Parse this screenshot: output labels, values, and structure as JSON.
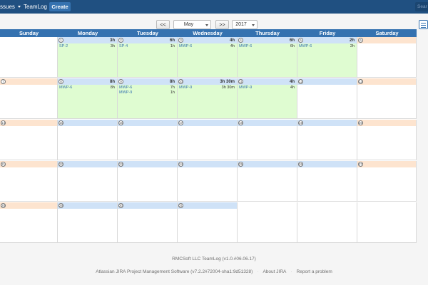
{
  "nav": {
    "issues_label": "ssues",
    "teamlog_label": "TeamLog",
    "create_label": "Create",
    "search_placeholder": "Sear"
  },
  "controls": {
    "prev_label": "<<",
    "next_label": ">>",
    "month": "May",
    "year": "2017"
  },
  "calendar": {
    "day_names": [
      "Sunday",
      "Monday",
      "Tuesday",
      "Wednesday",
      "Thursday",
      "Friday",
      "Saturday"
    ],
    "weeks": [
      {
        "days": [
          {
            "day": "",
            "total": "",
            "worked": false,
            "entries": []
          },
          {
            "day": "1",
            "total": "3h",
            "worked": true,
            "entries": [
              {
                "key": "SP-2",
                "hours": "3h"
              }
            ]
          },
          {
            "day": "2",
            "total": "6h",
            "worked": true,
            "entries": [
              {
                "key": "SP-4",
                "hours": "1h"
              }
            ]
          },
          {
            "day": "3",
            "total": "4h",
            "worked": true,
            "entries": [
              {
                "key": "MWP-6",
                "hours": "4h"
              }
            ]
          },
          {
            "day": "4",
            "total": "6h",
            "worked": true,
            "entries": [
              {
                "key": "MWP-6",
                "hours": "6h"
              }
            ]
          },
          {
            "day": "5",
            "total": "2h",
            "worked": true,
            "entries": [
              {
                "key": "MWP-6",
                "hours": "2h"
              }
            ]
          },
          {
            "day": "6",
            "total": "",
            "worked": false,
            "entries": []
          }
        ]
      },
      {
        "days": [
          {
            "day": "7",
            "total": "",
            "worked": false,
            "entries": []
          },
          {
            "day": "8",
            "total": "8h",
            "worked": true,
            "entries": [
              {
                "key": "MWP-6",
                "hours": "8h"
              }
            ]
          },
          {
            "day": "9",
            "total": "8h",
            "worked": true,
            "entries": [
              {
                "key": "MWP-6",
                "hours": "7h"
              },
              {
                "key": "MWP-9",
                "hours": "1h"
              }
            ]
          },
          {
            "day": "10",
            "total": "3h 30m",
            "worked": true,
            "entries": [
              {
                "key": "MWP-9",
                "hours": "3h 30m"
              }
            ]
          },
          {
            "day": "11",
            "total": "4h",
            "worked": true,
            "entries": [
              {
                "key": "MWP-9",
                "hours": "4h"
              }
            ]
          },
          {
            "day": "12",
            "total": "",
            "worked": false,
            "entries": []
          },
          {
            "day": "13",
            "total": "",
            "worked": false,
            "entries": []
          }
        ]
      },
      {
        "days": [
          {
            "day": "14",
            "total": "",
            "worked": false,
            "entries": []
          },
          {
            "day": "15",
            "total": "",
            "worked": false,
            "entries": []
          },
          {
            "day": "16",
            "total": "",
            "worked": false,
            "entries": []
          },
          {
            "day": "17",
            "total": "",
            "worked": false,
            "entries": []
          },
          {
            "day": "18",
            "total": "",
            "worked": false,
            "entries": []
          },
          {
            "day": "19",
            "total": "",
            "worked": false,
            "entries": []
          },
          {
            "day": "20",
            "total": "",
            "worked": false,
            "entries": []
          }
        ]
      },
      {
        "days": [
          {
            "day": "21",
            "total": "",
            "worked": false,
            "entries": []
          },
          {
            "day": "22",
            "total": "",
            "worked": false,
            "entries": []
          },
          {
            "day": "23",
            "total": "",
            "worked": false,
            "entries": []
          },
          {
            "day": "24",
            "total": "",
            "worked": false,
            "entries": []
          },
          {
            "day": "25",
            "total": "",
            "worked": false,
            "entries": []
          },
          {
            "day": "26",
            "total": "",
            "worked": false,
            "entries": []
          },
          {
            "day": "27",
            "total": "",
            "worked": false,
            "entries": []
          }
        ]
      },
      {
        "days": [
          {
            "day": "28",
            "total": "",
            "worked": false,
            "entries": []
          },
          {
            "day": "29",
            "total": "",
            "worked": false,
            "entries": []
          },
          {
            "day": "30",
            "total": "",
            "worked": false,
            "entries": []
          },
          {
            "day": "31",
            "total": "",
            "worked": false,
            "entries": []
          },
          {
            "day": "",
            "total": "",
            "worked": false,
            "entries": []
          },
          {
            "day": "",
            "total": "",
            "worked": false,
            "entries": []
          },
          {
            "day": "",
            "total": "",
            "worked": false,
            "entries": []
          }
        ]
      }
    ]
  },
  "footer": {
    "line1": "RMCSoft LLC TeamLog (v1.0.#06.06.17)",
    "software": "Atlassian JIRA Project Management Software (v7.2.2#72004-sha1:9d51328)",
    "about": "About JIRA",
    "report": "Report a problem"
  },
  "colors": {
    "nav_bg": "#205081",
    "calendar_header_bg": "#3572b0",
    "weekday_head_bg": "#cfe2f7",
    "weekend_head_bg": "#fde4cf",
    "worked_bg": "#dffcd1",
    "issue_link": "#3572b0"
  }
}
